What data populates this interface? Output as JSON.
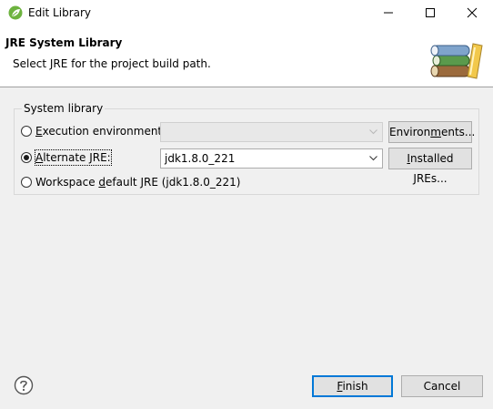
{
  "window": {
    "title": "Edit Library",
    "icon": "spring-leaf-icon"
  },
  "banner": {
    "title": "JRE System Library",
    "message": "Select JRE for the project build path.",
    "image": "library-books-icon"
  },
  "group": {
    "title": "System library",
    "options": [
      {
        "prefix": "",
        "mnemonic": "E",
        "suffix": "xecution environment:",
        "selected": false
      },
      {
        "prefix": "",
        "mnemonic": "A",
        "suffix": "lternate JRE:",
        "selected": true
      },
      {
        "prefix": "Workspace ",
        "mnemonic": "d",
        "suffix": "efault JRE (jdk1.8.0_221)",
        "selected": false
      }
    ],
    "execution_env_value": "",
    "alternate_jre_value": "jdk1.8.0_221",
    "environments_button": {
      "prefix": "Environ",
      "mnemonic": "m",
      "suffix": "ents..."
    },
    "installed_jres_button": {
      "prefix": "",
      "mnemonic": "I",
      "suffix": "nstalled JREs..."
    }
  },
  "footer": {
    "finish": {
      "mnemonic": "F",
      "suffix": "inish"
    },
    "cancel": "Cancel",
    "help_icon": "help-icon"
  },
  "colors": {
    "background": "#f0f0f0",
    "default_button_border": "#0078d7",
    "leaf_green": "#6db33f"
  }
}
